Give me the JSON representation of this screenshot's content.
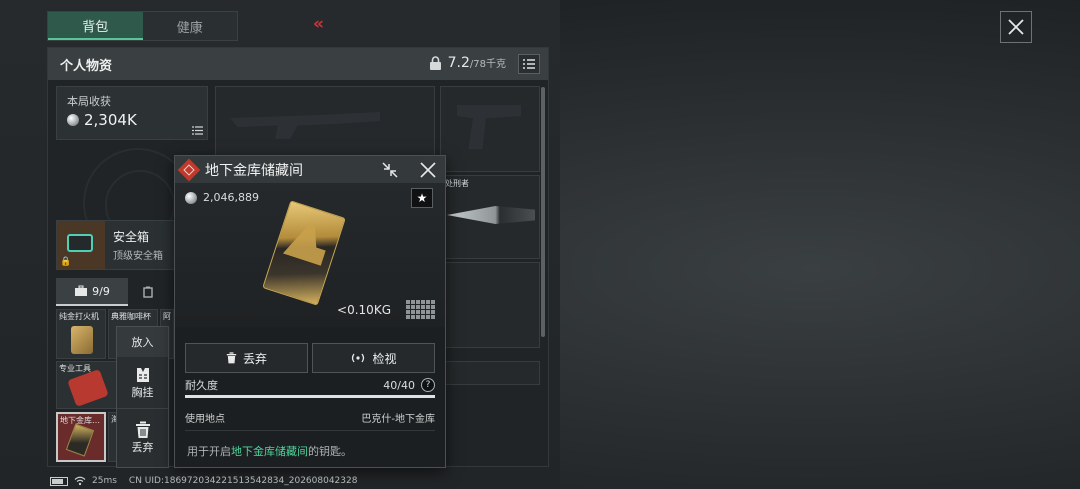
{
  "top_tabs": [
    "背包",
    "健康"
  ],
  "personal": {
    "title": "个人物资",
    "weight_current": "7.2",
    "weight_capacity": "/78千克"
  },
  "loot": {
    "label": "本局收获",
    "value": "2,304K"
  },
  "safe_box": {
    "title": "安全箱",
    "subtitle": "顶级安全箱"
  },
  "sub_tabs": {
    "active": "9/9"
  },
  "grid_items": {
    "lighter": "纯金打火机",
    "coffee": "典雅咖啡杯",
    "third": "阿",
    "tool": "专业工具",
    "keycard": "地下金库…",
    "next": "海"
  },
  "slot_label": "处刑者",
  "context_menu": {
    "put_in": "放入",
    "chest": "胸挂",
    "discard": "丢弃"
  },
  "popup": {
    "title": "地下金库储藏间",
    "price": "2,046,889",
    "weight": "<0.10KG",
    "discard": "丢弃",
    "inspect": "检视",
    "durability_label": "耐久度",
    "durability_value": "40/40",
    "durability_fraction": 1.0,
    "location_label": "使用地点",
    "location_value": "巴克什-地下金库",
    "desc_prefix": "用于开启",
    "desc_highlight": "地下金库储藏间",
    "desc_suffix": "的钥匙。"
  },
  "status": {
    "ping": "25ms",
    "uid": "CN UID:18697203422151354283​4_202608042328"
  },
  "colors": {
    "accent_green": "#4fd39b",
    "tab_active": "#2f5a4b",
    "danger_red": "#c0392b"
  }
}
